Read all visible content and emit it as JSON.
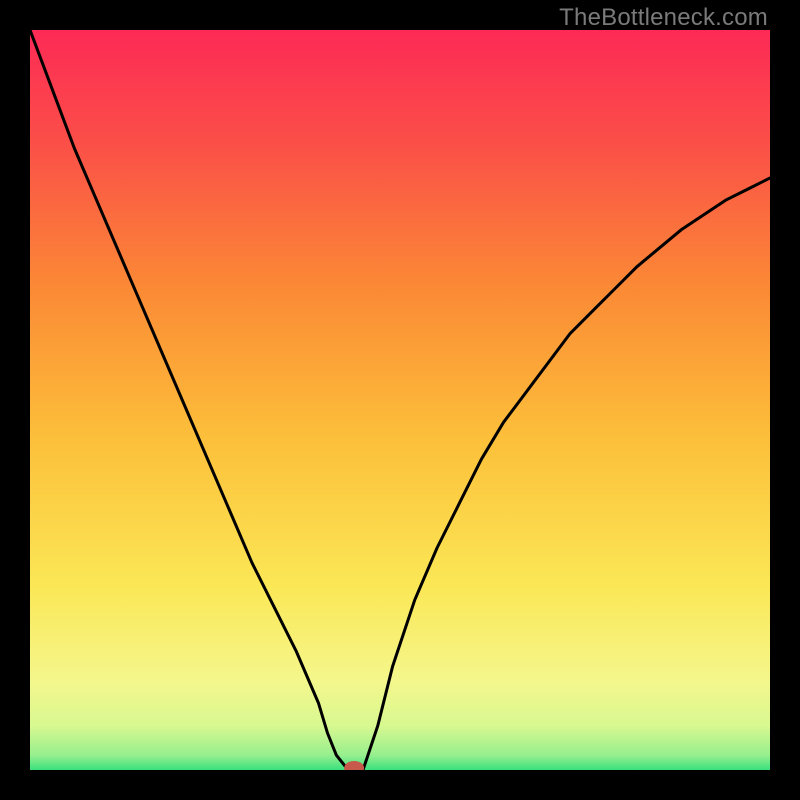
{
  "watermark": "TheBottleneck.com",
  "chart_data": {
    "type": "line",
    "title": "",
    "xlabel": "",
    "ylabel": "",
    "xlim": [
      0,
      100
    ],
    "ylim": [
      0,
      100
    ],
    "grid": false,
    "legend": false,
    "series": [
      {
        "name": "curve",
        "x": [
          0,
          3,
          6,
          9,
          12,
          15,
          18,
          21,
          24,
          27,
          30,
          33,
          36,
          39,
          40.2,
          41.4,
          42.6,
          43.8,
          45,
          47,
          49,
          52,
          55,
          58,
          61,
          64,
          67,
          70,
          73,
          76,
          79,
          82,
          85,
          88,
          91,
          94,
          97,
          100
        ],
        "y": [
          100,
          92,
          84,
          77,
          70,
          63,
          56,
          49,
          42,
          35,
          28,
          22,
          16,
          9,
          5,
          2,
          0.5,
          0,
          0,
          6,
          14,
          23,
          30,
          36,
          42,
          47,
          51,
          55,
          59,
          62,
          65,
          68,
          70.5,
          73,
          75,
          77,
          78.5,
          80
        ]
      }
    ],
    "marker": {
      "x": 43.8,
      "y": 0,
      "color": "#c75a4a"
    },
    "gradient_bands": [
      {
        "y": 0,
        "color": "#39e07f"
      },
      {
        "y": 2,
        "color": "#97ef8e"
      },
      {
        "y": 6,
        "color": "#d8f890"
      },
      {
        "y": 12,
        "color": "#f4f78c"
      },
      {
        "y": 25,
        "color": "#fbe755"
      },
      {
        "y": 45,
        "color": "#fcbf3a"
      },
      {
        "y": 65,
        "color": "#fb8a35"
      },
      {
        "y": 85,
        "color": "#fb4e48"
      },
      {
        "y": 100,
        "color": "#fd2a56"
      }
    ]
  }
}
